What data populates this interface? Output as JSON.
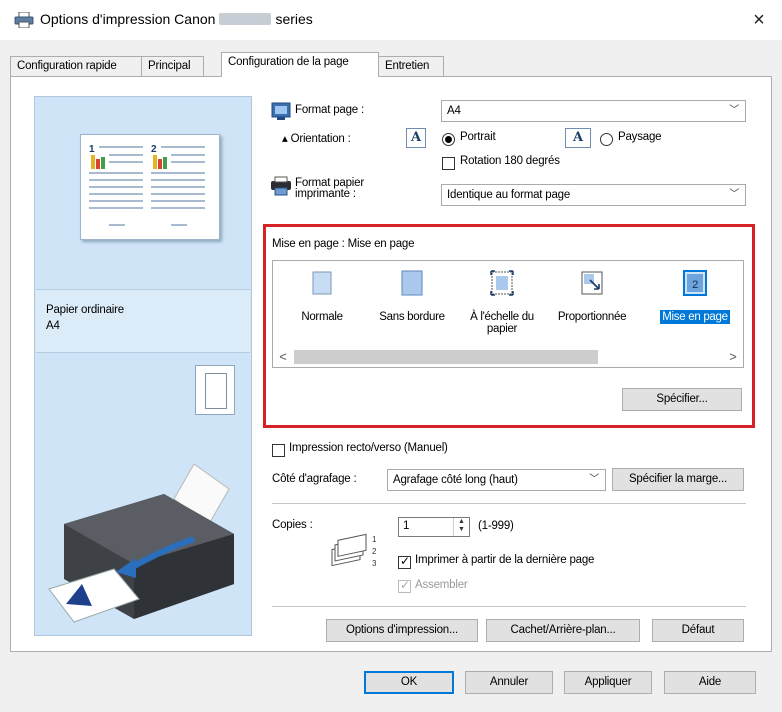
{
  "window": {
    "title_prefix": "Options d'impression Canon",
    "title_suffix": "series",
    "close": "×"
  },
  "tabs": [
    {
      "label": "Configuration rapide",
      "active": false
    },
    {
      "label": "Principal",
      "active": false
    },
    {
      "label": "Configuration de la page",
      "active": true
    },
    {
      "label": "Entretien",
      "active": false
    }
  ],
  "preview": {
    "media_type": "Papier ordinaire",
    "paper_size": "A4"
  },
  "page_setup": {
    "format_page_label": "Format page :",
    "format_page_value": "A4",
    "orientation_label": "Orientation :",
    "portrait_label": "Portrait",
    "landscape_label": "Paysage",
    "orientation_selected": "Portrait",
    "rotation_label": "Rotation 180 degrés",
    "rotation_checked": false,
    "printer_paper_label_1": "Format papier",
    "printer_paper_label_2": "imprimante :",
    "printer_paper_value": "Identique au format page"
  },
  "layout": {
    "heading": "Mise en page : Mise en page",
    "items": [
      {
        "label": "Normale",
        "selected": false
      },
      {
        "label": "Sans bordure",
        "selected": false
      },
      {
        "label": "À l'échelle du papier",
        "selected": false
      },
      {
        "label": "Proportionnée",
        "selected": false
      },
      {
        "label": "Mise en page",
        "selected": true
      }
    ],
    "specify_button": "Spécifier...",
    "scroll_left": "<",
    "scroll_right": ">"
  },
  "duplex": {
    "label": "Impression recto/verso (Manuel)",
    "checked": false
  },
  "stapling": {
    "label": "Côté d'agrafage :",
    "value": "Agrafage côté long (haut)",
    "margin_button": "Spécifier la marge..."
  },
  "copies": {
    "label": "Copies :",
    "value": "1",
    "range": "(1-999)",
    "reverse_label": "Imprimer à partir de la dernière page",
    "reverse_checked": true,
    "collate_label": "Assembler",
    "collate_checked": true,
    "collate_enabled": false
  },
  "buttons": {
    "print_options": "Options d'impression...",
    "stamp_background": "Cachet/Arrière-plan...",
    "defaults": "Défaut"
  },
  "dialog_buttons": {
    "ok": "OK",
    "cancel": "Annuler",
    "apply": "Appliquer",
    "help": "Aide"
  },
  "colors": {
    "highlight_border": "#d62224",
    "selection_blue": "#0078d7",
    "preview_bg": "#cfe4f7"
  }
}
